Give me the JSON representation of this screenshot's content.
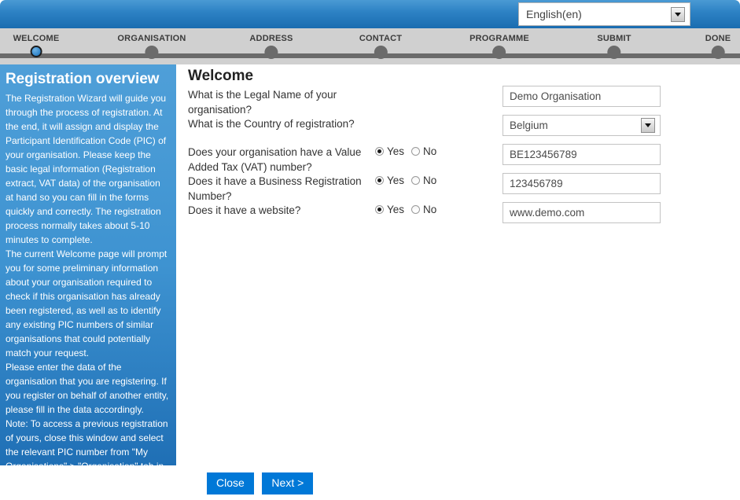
{
  "header": {
    "language_value": "English(en)",
    "language_options": [
      "English(en)"
    ],
    "dropdown_icon": "chevron-down-icon"
  },
  "stepper": {
    "steps": [
      {
        "label": "WELCOME",
        "active": true
      },
      {
        "label": "ORGANISATION",
        "active": false
      },
      {
        "label": "ADDRESS",
        "active": false
      },
      {
        "label": "CONTACT",
        "active": false
      },
      {
        "label": "PROGRAMME",
        "active": false
      },
      {
        "label": "SUBMIT",
        "active": false
      },
      {
        "label": "DONE",
        "active": false
      }
    ]
  },
  "sidebar": {
    "title": "Registration overview",
    "paragraphs": [
      "The Registration Wizard will guide you through the process of registration. At the end, it will assign and display the Participant Identification Code (PIC) of your organisation. Please keep the basic legal information (Registration extract, VAT data) of the organisation at hand so you can fill in the forms quickly and correctly. The registration process normally takes about 5-10 minutes to complete.",
      "The current Welcome page will prompt you for some preliminary information about your organisation required to check if this organisation has already been registered, as well as to identify any existing PIC numbers of similar organisations that could potentially match your request.",
      "Please enter the data of the organisation that you are registering. If you register on behalf of another entity, please fill in the data accordingly.",
      "Note: To access a previous registration of yours, close this window and select the relevant PIC number from \"My Organisations\" > \"Organisation\" tab in the Participant Portal."
    ]
  },
  "main": {
    "title": "Welcome",
    "questions": [
      {
        "text": "What is the Legal Name of your organisation?"
      },
      {
        "text": "What is the Country of registration?"
      },
      {
        "text": "Does your organisation have a Value Added Tax (VAT) number?"
      },
      {
        "text": "Does it have a Business Registration Number?"
      },
      {
        "text": "Does it have a website?"
      }
    ],
    "radio_groups": [
      {
        "yes_label": "Yes",
        "no_label": "No",
        "selected": "Yes"
      },
      {
        "yes_label": "Yes",
        "no_label": "No",
        "selected": "Yes"
      },
      {
        "yes_label": "Yes",
        "no_label": "No",
        "selected": "Yes"
      }
    ],
    "fields": [
      {
        "name": "legal-name",
        "value": "Demo Organisation",
        "type": "text"
      },
      {
        "name": "country",
        "value": "Belgium",
        "type": "select"
      },
      {
        "name": "vat-number",
        "value": "BE123456789",
        "type": "text"
      },
      {
        "name": "business-registration-number",
        "value": "123456789",
        "type": "text"
      },
      {
        "name": "website",
        "value": "www.demo.com",
        "type": "text"
      }
    ]
  },
  "footer": {
    "close_label": "Close",
    "next_label": "Next >"
  },
  "colors": {
    "header_blue": "#2d82c4",
    "sidebar_blue": "#3e93d1",
    "stepper_grey": "#d0d0d0",
    "rail_grey": "#6b6b6b",
    "button_blue": "#0078d7"
  }
}
